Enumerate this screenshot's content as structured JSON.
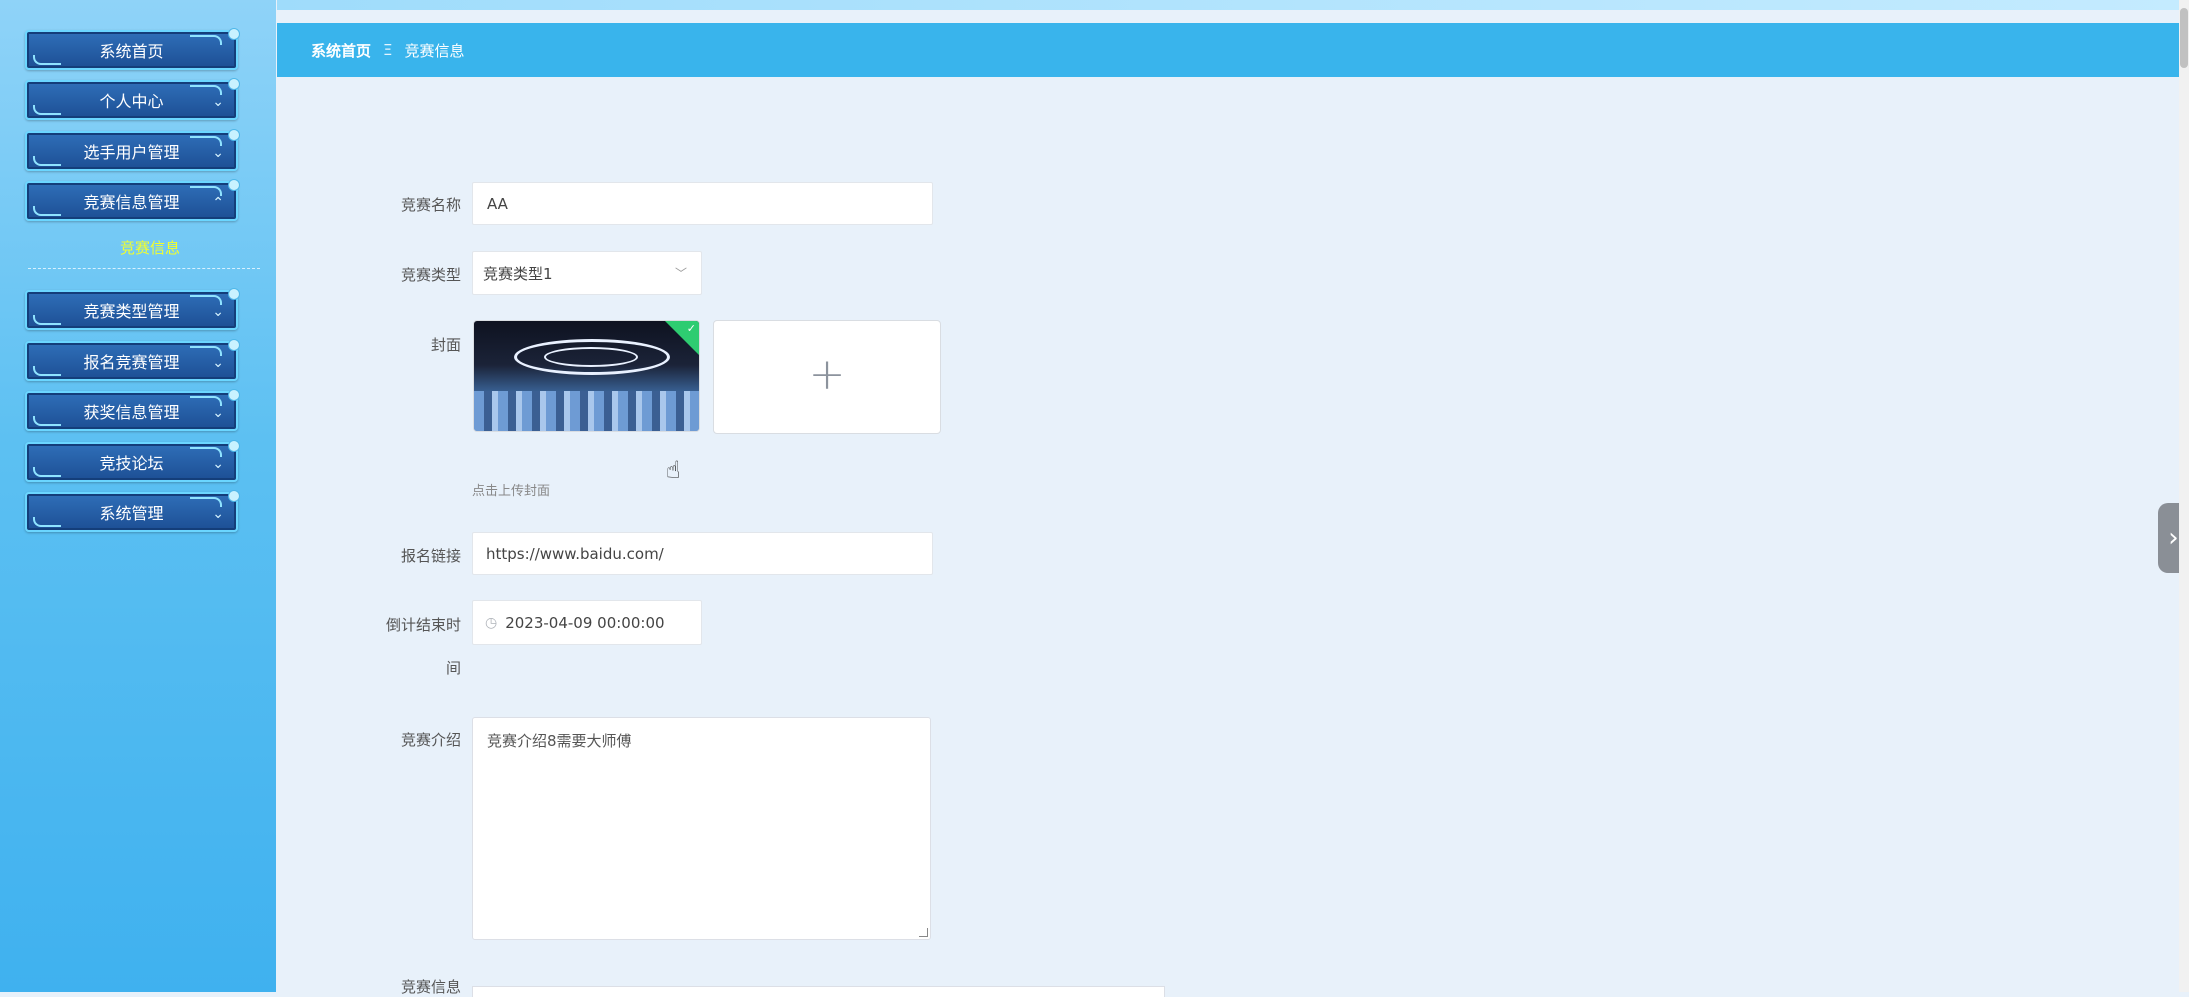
{
  "sidebar": {
    "menu": [
      {
        "label": "系统首页"
      },
      {
        "label": "个人中心"
      },
      {
        "label": "选手用户管理"
      },
      {
        "label": "竞赛信息管理"
      },
      {
        "label": "竞赛类型管理"
      },
      {
        "label": "报名竞赛管理"
      },
      {
        "label": "获奖信息管理"
      },
      {
        "label": "竞技论坛"
      },
      {
        "label": "系统管理"
      }
    ],
    "active_sub_item": "竞赛信息"
  },
  "breadcrumb": {
    "home": "系统首页",
    "separator": "Ξ",
    "current": "竞赛信息"
  },
  "form": {
    "name_label": "竞赛名称",
    "name_value": "AA",
    "type_label": "竞赛类型",
    "type_value": "竞赛类型1",
    "cover_label": "封面",
    "cover_hint": "点击上传封面",
    "cover_add_symbol": "+",
    "link_label": "报名链接",
    "link_value": "https://www.baidu.com/",
    "countdown_label_line1": "倒计结束时",
    "countdown_label_line2": "间",
    "countdown_value": "2023-04-09 00:00:00",
    "intro_label": "竞赛介绍",
    "intro_value": "竞赛介绍8需要大师傅",
    "info_label": "竞赛信息"
  },
  "colors": {
    "breadcrumb_bar": "#39b4ec",
    "active_sub_item": "#f3ff2b",
    "menu_button": "#1d4f95"
  }
}
